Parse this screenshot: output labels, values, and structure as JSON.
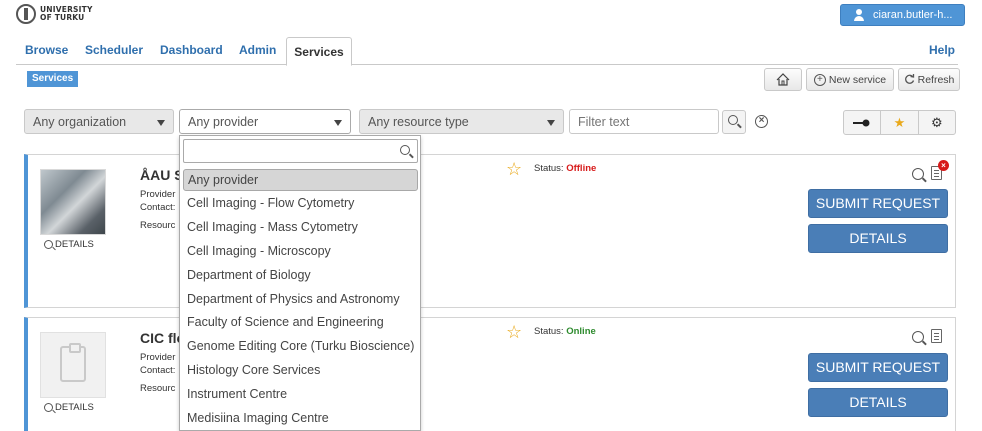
{
  "header": {
    "logo_line1": "UNIVERSITY",
    "logo_line2": "OF TURKU",
    "user_label": "ciaran.butler-h..."
  },
  "nav": {
    "tabs": [
      {
        "label": "Browse"
      },
      {
        "label": "Scheduler"
      },
      {
        "label": "Dashboard"
      },
      {
        "label": "Admin"
      },
      {
        "label": "Services"
      }
    ],
    "active": "Services",
    "help": "Help"
  },
  "subheader": {
    "badge": "Services",
    "new_service": "New service",
    "refresh": "Refresh"
  },
  "filters": {
    "organization": "Any organization",
    "provider": "Any provider",
    "resource_type": "Any resource type",
    "filter_placeholder": "Filter text"
  },
  "cards": [
    {
      "title": "ÅAU S",
      "provider_label": "Provider",
      "contact_label": "Contact:",
      "resource_label": "Resourc",
      "details": "DETAILS",
      "status_label": "Status:",
      "status_value": "Offline",
      "submit": "SUBMIT REQUEST",
      "details_btn": "DETAILS"
    },
    {
      "title": "CIC flo",
      "provider_label": "Provider",
      "contact_label": "Contact:",
      "resource_label": "Resourc",
      "details": "DETAILS",
      "status_label": "Status:",
      "status_value": "Online",
      "submit": "SUBMIT REQUEST",
      "details_btn": "DETAILS"
    }
  ],
  "dropdown": {
    "items": [
      "Any provider",
      "Cell Imaging - Flow Cytometry",
      "Cell Imaging - Mass Cytometry",
      "Cell Imaging - Microscopy",
      "Department of Biology",
      "Department of Physics and Astronomy",
      "Faculty of Science and Engineering",
      "Genome Editing Core (Turku Bioscience)",
      "Histology Core Services",
      "Instrument Centre",
      "Medisiina Imaging Centre"
    ],
    "selected": "Any provider"
  },
  "colors": {
    "accent": "#4f95d6",
    "button": "#4a7eb7",
    "offline": "#d71b1b",
    "online": "#2e8b2e",
    "star": "#e9a91b"
  }
}
